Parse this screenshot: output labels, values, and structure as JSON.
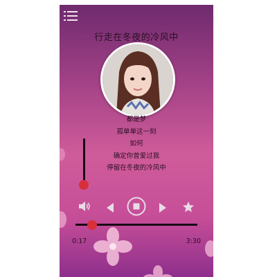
{
  "player": {
    "song_title": "行走在冬夜的冷风中",
    "lyrics": [
      "都是梦",
      "孤单单这一刻",
      "如何",
      "确定你曾爱过我",
      "停留在冬夜的冷风中"
    ],
    "current_time": "0:17",
    "total_time": "3:30",
    "progress": 0.08,
    "volume": 0.17
  },
  "icons": {
    "menu": "menu-icon",
    "volume": "speaker-icon",
    "previous": "previous-icon",
    "stop": "stop-icon",
    "next": "next-icon",
    "favorite": "star-icon"
  },
  "colors": {
    "accent": "#d8303a",
    "control": "#e9dbe7",
    "text": "#2a0f24"
  }
}
